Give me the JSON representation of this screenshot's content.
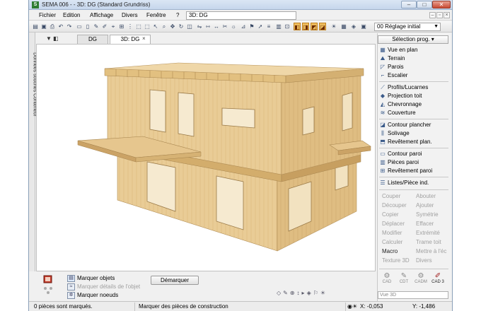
{
  "window": {
    "app_badge": "S",
    "title": "SEMA  006 -   - 3D: DG (Standard Grundriss)",
    "minimize": "–",
    "maximize": "□",
    "close": "✕"
  },
  "menu": {
    "items": [
      "Fichier",
      "Edition",
      "Affichage",
      "Divers",
      "Fenêtre",
      "?"
    ],
    "document_field": "3D: DG"
  },
  "toolbar": {
    "layer_select": "00 Réglage initial"
  },
  "left_tab": {
    "label": "Données souches Conteneur"
  },
  "tabs": [
    {
      "label": "DG"
    },
    {
      "label": "3D: DG",
      "active": true
    }
  ],
  "right_panel": {
    "header": "Sélection prog.",
    "groups": [
      [
        "Vue en plan",
        "Terrain",
        "Parois",
        "Escalier"
      ],
      [
        "Profils/Lucarnes",
        "Projection toit",
        "Chevronnage",
        "Couverture"
      ],
      [
        "Contour plancher",
        "Solivage",
        "Revêtement plan."
      ],
      [
        "Contour paroi",
        "Pièces paroi",
        "Revêtement paroi"
      ],
      [
        "Listes/Pièce ind."
      ]
    ],
    "commands_left": [
      "Couper",
      "Découper",
      "Copier",
      "Déplacer",
      "Modifier",
      "Calculer",
      "Macro",
      "Texture 3D"
    ],
    "commands_right": [
      "Abouter",
      "Ajouter",
      "Symétrie",
      "Effacer",
      "Extrémité",
      "Trame toit",
      "Mettre à l'éc",
      "Divers"
    ],
    "cad_buttons": [
      "CAD",
      "CDT",
      "CADM",
      "CAD 3"
    ],
    "view_select": "Vue 3D"
  },
  "bottom": {
    "mark_objects": "Marquer objets",
    "mark_details": "Marquer détails de l'objet",
    "mark_nodes": "Marquer noeuds",
    "unmark_button": "Démarquer"
  },
  "status": {
    "marked": "0 pièces sont marqués.",
    "hint": "Marquer des pièces de construction",
    "x": "X: -0,053",
    "y": "Y: -1,486"
  },
  "colors": {
    "timber": "#e6c78f",
    "timber_dark": "#c9a468",
    "highlight": "#f0c060",
    "titlebar": "#c6d6ec"
  }
}
